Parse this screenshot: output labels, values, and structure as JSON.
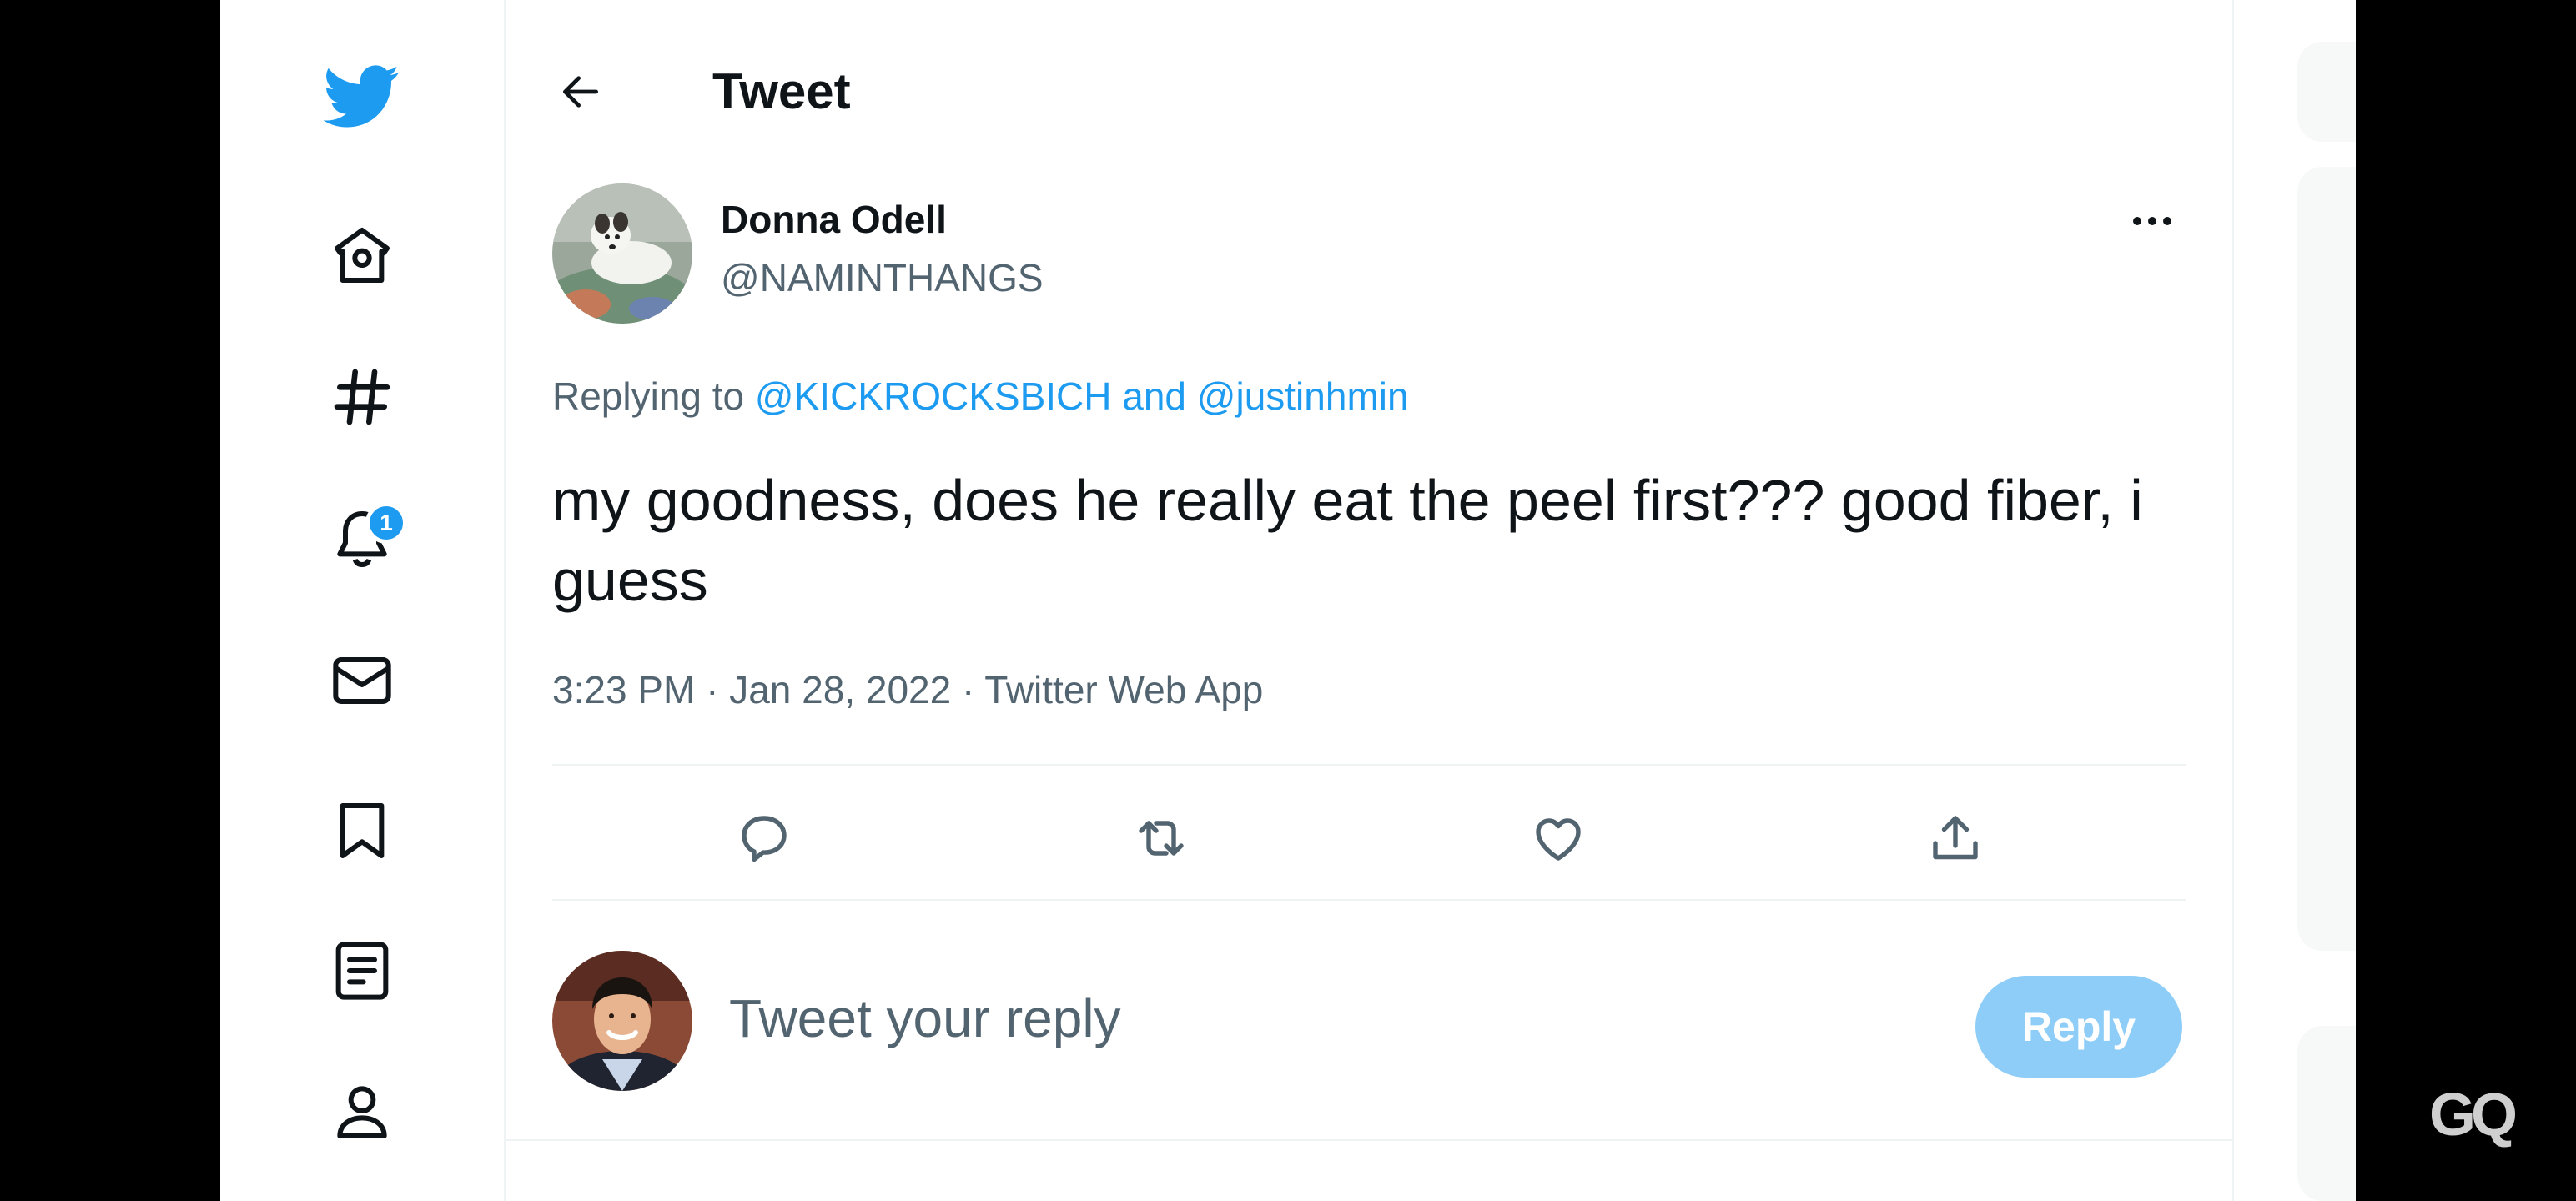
{
  "header": {
    "title": "Tweet"
  },
  "nav": {
    "items": [
      {
        "icon": "twitter-bird-icon"
      },
      {
        "icon": "home-icon"
      },
      {
        "icon": "explore-hashtag-icon"
      },
      {
        "icon": "notifications-bell-icon",
        "badge": "1"
      },
      {
        "icon": "messages-envelope-icon"
      },
      {
        "icon": "bookmark-icon"
      },
      {
        "icon": "lists-icon"
      },
      {
        "icon": "profile-icon"
      }
    ]
  },
  "tweet": {
    "author_name": "Donna Odell",
    "author_handle": "@NAMINTHANGS",
    "replying_prefix": "Replying to",
    "replying_user1": "@KICKROCKSBICH",
    "replying_and": "and",
    "replying_user2": "@justinhmin",
    "text": "my goodness, does he really eat the peel first??? good fiber, i guess",
    "time": "3:23 PM",
    "date": "Jan 28, 2022",
    "source": "Twitter Web App",
    "separator": "·"
  },
  "actions": [
    {
      "icon": "reply-icon"
    },
    {
      "icon": "retweet-icon"
    },
    {
      "icon": "like-heart-icon"
    },
    {
      "icon": "share-icon"
    }
  ],
  "compose": {
    "placeholder": "Tweet your reply",
    "reply_button": "Reply"
  },
  "watermark": "GQ",
  "colors": {
    "brand_blue": "#1d9bf0",
    "reply_button_disabled": "#8ecdf7",
    "text_primary": "#0f1419",
    "text_secondary": "#536471"
  }
}
